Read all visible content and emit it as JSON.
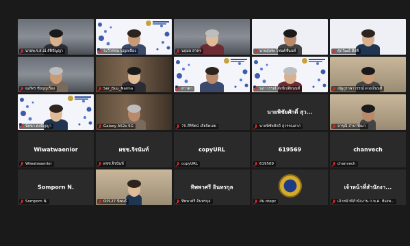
{
  "participants": [
    {
      "name": "นายพ.ร.ส.ณ์ สัติปัญญา",
      "type": "video",
      "bg": "room",
      "center": ""
    },
    {
      "name": "ระวีวรรณ บุญเหลือง",
      "type": "video",
      "bg": "dots",
      "center": ""
    },
    {
      "name": "นฤมล สาคร",
      "type": "video",
      "bg": "room",
      "center": ""
    },
    {
      "name": "นายสุเทพ โชนต์ชั้นนท์",
      "type": "video",
      "bg": "white",
      "center": ""
    },
    {
      "name": "ศุภวัฒน์ มีสติ",
      "type": "video",
      "bg": "white",
      "center": ""
    },
    {
      "name": "ณภัทร ชัยบุญเรือง",
      "type": "video",
      "bg": "room",
      "center": ""
    },
    {
      "name": "Ser_Buu_Naima",
      "type": "video",
      "bg": "shelf",
      "center": ""
    },
    {
      "name": "สาวตา",
      "type": "video",
      "bg": "dots",
      "center": ""
    },
    {
      "name": "นภาวรรณ์ สังข์เปลี่ยนนท์",
      "type": "video",
      "bg": "dots",
      "center": ""
    },
    {
      "name": "ณัฐภูราพาวรรณ์ ดวงเงินนท์",
      "type": "video",
      "bg": "office",
      "center": ""
    },
    {
      "name": "นัยนา คงปัญญา",
      "type": "video",
      "bg": "dots",
      "center": ""
    },
    {
      "name": "Galaxy A52s 5G",
      "type": "video",
      "bg": "shelf",
      "center": ""
    },
    {
      "name": "70.สิริรัตน์ เสียจิตเลย",
      "type": "name",
      "bg": "dark",
      "center": ""
    },
    {
      "name": "นายพิชัยศักดิ์ สุวรรณลาภ",
      "type": "name",
      "bg": "dark",
      "center": "นายพิชัยศักดิ์ สุว..."
    },
    {
      "name": "จารุณี จำปาฟิเมา",
      "type": "photo",
      "bg": "office",
      "center": ""
    },
    {
      "name": "Wiwatwaenlor",
      "type": "name",
      "bg": "dark",
      "center": "Wiwatwaenlor"
    },
    {
      "name": "ผชช.จิรนันท์",
      "type": "name",
      "bg": "dark",
      "center": "ผชช.จิรนันท์"
    },
    {
      "name": "copyURL",
      "type": "name",
      "bg": "dark",
      "center": "copyURL"
    },
    {
      "name": "619569",
      "type": "name",
      "bg": "dark",
      "center": "619569"
    },
    {
      "name": "chanvech",
      "type": "name",
      "bg": "dark",
      "center": "chanvech"
    },
    {
      "name": "Somporn N.",
      "type": "name",
      "bg": "dark",
      "center": "Somporn N."
    },
    {
      "name": "OP127 นิพนธ์",
      "type": "photo",
      "bg": "office",
      "center": ""
    },
    {
      "name": "ทิพพาศรี อินทรกุล",
      "type": "name",
      "bg": "dark",
      "center": "ทิพพาศรี อินทรกุล"
    },
    {
      "name": "สน otepc",
      "type": "logo",
      "bg": "dark",
      "center": ""
    },
    {
      "name": "เจ้าหน้าที่สำนักงาน ก.พ.ค. ห้องพ...",
      "type": "name",
      "bg": "dark",
      "center": "เจ้าหน้าที่สำนักงา..."
    }
  ],
  "colors": {
    "muted_mic": "#e02828",
    "tile_bg": "#222222",
    "page_bg": "#1a1a1a"
  }
}
